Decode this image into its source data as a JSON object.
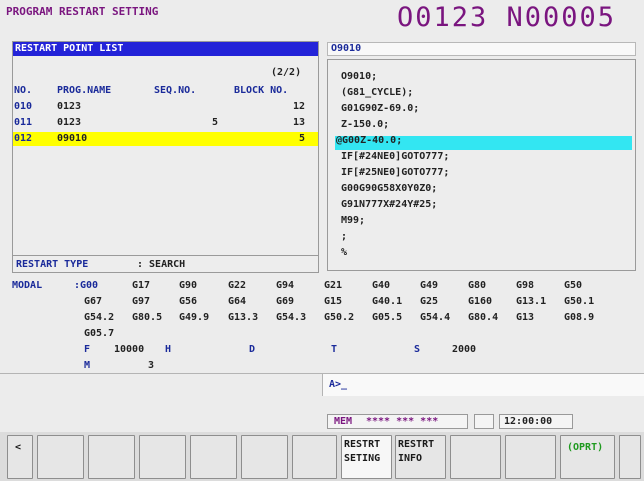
{
  "screen": {
    "title": "PROGRAM RESTART SETTING",
    "program_number": "O0123 N00005"
  },
  "restart_list": {
    "header": "RESTART POINT LIST",
    "page": "(2/2)",
    "columns": {
      "no": "NO.",
      "prog": "PROG.NAME",
      "seq": "SEQ.NO.",
      "block": "BLOCK NO."
    },
    "rows": [
      {
        "no": "010",
        "prog": "0123",
        "seq": "",
        "block": "12"
      },
      {
        "no": "011",
        "prog": "0123",
        "seq": "5",
        "block": "13"
      },
      {
        "no": "012",
        "prog": "09010",
        "seq": "",
        "block": "5"
      }
    ],
    "restart_type_label": "RESTART TYPE",
    "restart_type_value": ": SEARCH"
  },
  "program": {
    "header": "O9010",
    "lines": [
      "O9010;",
      "(G81_CYCLE);",
      "G01G90Z-69.0;",
      "Z-150.0;",
      "@G00Z-40.0;",
      "IF[#24NE0]GOTO777;",
      "IF[#25NE0]GOTO777;",
      "G00G90G58X0Y0Z0;",
      "G91N777X#24Y#25;",
      "M99;",
      ";",
      "%"
    ]
  },
  "modal": {
    "label": "MODAL",
    "rows": [
      [
        ":G00",
        "G17",
        "G90",
        "G22",
        "G94",
        "G21",
        "G40",
        "G49",
        "G80",
        "G98",
        "G50"
      ],
      [
        "G67",
        "G97",
        "G56",
        "G64",
        "G69",
        "G15",
        "G40.1",
        "G25",
        "G160",
        "G13.1",
        "G50.1"
      ],
      [
        "G54.2",
        "G80.5",
        "G49.9",
        "G13.3",
        "G54.3",
        "G50.2",
        "G05.5",
        "G54.4",
        "G80.4",
        "G13",
        "G08.9"
      ],
      [
        "G05.7"
      ]
    ],
    "f_label": "F",
    "f_value": "10000",
    "h_label": "H",
    "d_label": "D",
    "t_label": "T",
    "s_label": "S",
    "s_value": "2000",
    "m_label": "M",
    "m_value": "3"
  },
  "input_line": {
    "prompt": "A>_"
  },
  "status": {
    "mode": "MEM",
    "stars": "**** *** ***",
    "time": "12:00:00"
  },
  "softkeys": {
    "left_arrow": "<",
    "restart_setting": [
      "RESTRT",
      "SETING"
    ],
    "restart_info": [
      "RESTRT",
      "INFO"
    ],
    "oprt": "(OPRT)"
  },
  "colors": {
    "title": "#7a157f",
    "header_bar": "#2323d8",
    "highlight_row": "#ffff00",
    "cursor_line": "#33e6f2",
    "label_blue": "#1a2a9a"
  }
}
